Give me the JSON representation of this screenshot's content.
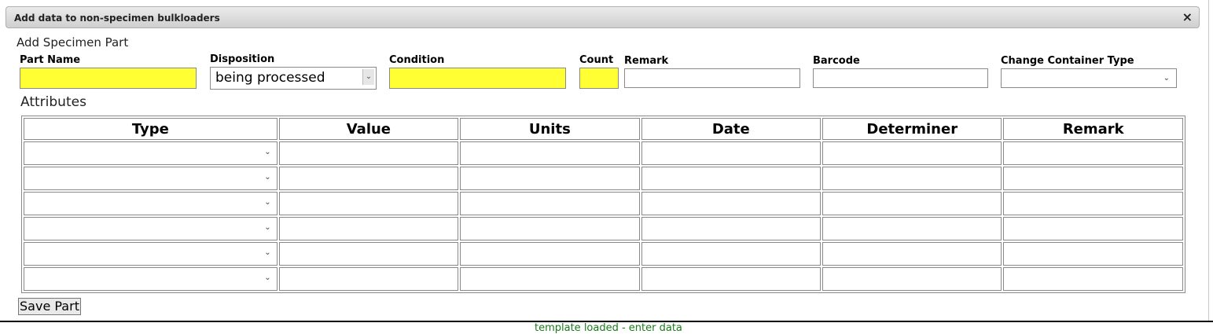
{
  "dialog": {
    "title": "Add data to non-specimen bulkloaders",
    "close_symbol": "×"
  },
  "form": {
    "heading": "Add Specimen Part",
    "labels": {
      "part_name": "Part Name",
      "disposition": "Disposition",
      "condition": "Condition",
      "count": "Count",
      "remark": "Remark",
      "barcode": "Barcode",
      "container_type": "Change Container Type"
    },
    "disposition_value": "being processed"
  },
  "attributes": {
    "heading": "Attributes",
    "columns": [
      "Type",
      "Value",
      "Units",
      "Date",
      "Determiner",
      "Remark"
    ],
    "row_count": 6
  },
  "save_label": "Save Part",
  "status": "template loaded - enter data",
  "colors": {
    "required_field": "#ffff33",
    "status_text": "#1a7a1a"
  }
}
